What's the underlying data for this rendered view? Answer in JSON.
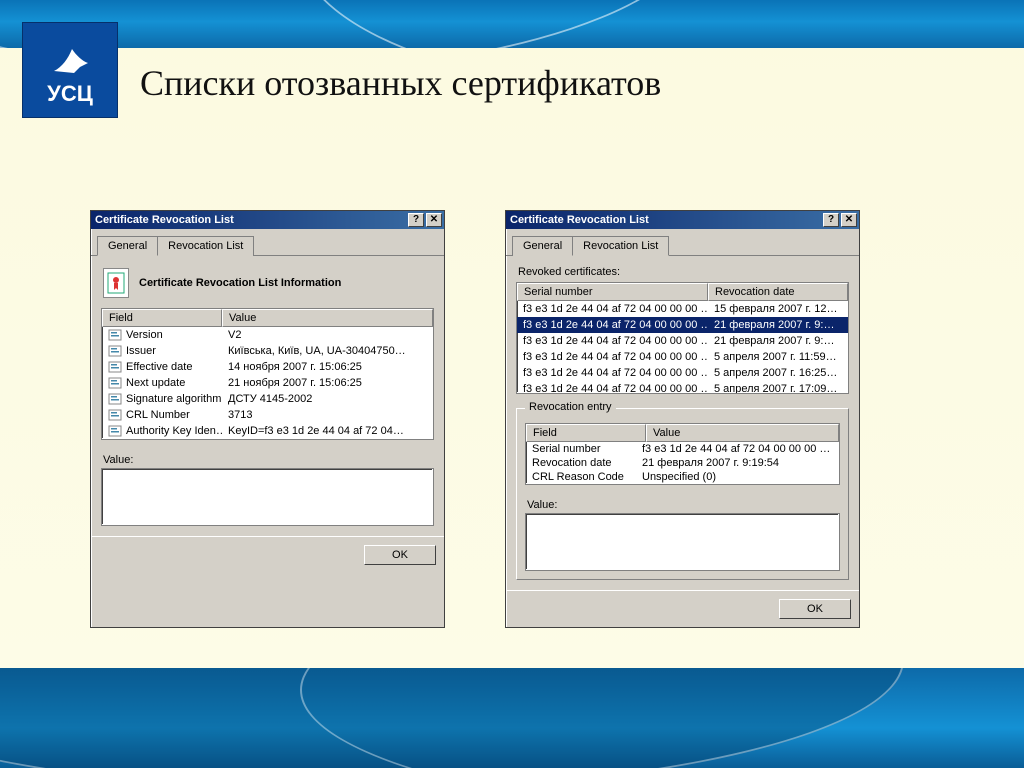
{
  "slide": {
    "title": "Списки отозванных сертификатов"
  },
  "logo": {
    "text": "УСЦ"
  },
  "dialog_general": {
    "title": "Certificate Revocation List",
    "tabs": {
      "general": "General",
      "revlist": "Revocation List"
    },
    "heading": "Certificate Revocation List Information",
    "columns": {
      "field": "Field",
      "value": "Value"
    },
    "rows": [
      {
        "field": "Version",
        "value": "V2"
      },
      {
        "field": "Issuer",
        "value": "Київська, Київ, UA, UA-30404750…"
      },
      {
        "field": "Effective date",
        "value": "14 ноября 2007 г. 15:06:25"
      },
      {
        "field": "Next update",
        "value": "21 ноября 2007 г. 15:06:25"
      },
      {
        "field": "Signature algorithm",
        "value": "ДСТУ 4145-2002"
      },
      {
        "field": "CRL Number",
        "value": "3713"
      },
      {
        "field": "Authority Key Iden…",
        "value": "KeyID=f3 e3 1d 2e 44 04 af 72 04…"
      }
    ],
    "value_label": "Value:",
    "ok": "OK"
  },
  "dialog_revlist": {
    "title": "Certificate Revocation List",
    "tabs": {
      "general": "General",
      "revlist": "Revocation List"
    },
    "list_label": "Revoked certificates:",
    "columns": {
      "serial": "Serial number",
      "revdate": "Revocation date"
    },
    "rows": [
      {
        "serial": "f3 e3 1d 2e 44 04 af 72 04 00 00 00 …",
        "date": "15 февраля 2007 г. 12…",
        "selected": false
      },
      {
        "serial": "f3 e3 1d 2e 44 04 af 72 04 00 00 00 …",
        "date": "21 февраля 2007 г. 9:…",
        "selected": true
      },
      {
        "serial": "f3 e3 1d 2e 44 04 af 72 04 00 00 00 …",
        "date": "21 февраля 2007 г. 9:…",
        "selected": false
      },
      {
        "serial": "f3 e3 1d 2e 44 04 af 72 04 00 00 00 …",
        "date": "5 апреля 2007 г. 11:59…",
        "selected": false
      },
      {
        "serial": "f3 e3 1d 2e 44 04 af 72 04 00 00 00 …",
        "date": "5 апреля 2007 г. 16:25…",
        "selected": false
      },
      {
        "serial": "f3 e3 1d 2e 44 04 af 72 04 00 00 00 …",
        "date": "5 апреля 2007 г. 17:09…",
        "selected": false
      }
    ],
    "entry_group": "Revocation entry",
    "entry_columns": {
      "field": "Field",
      "value": "Value"
    },
    "entry_rows": [
      {
        "field": "Serial number",
        "value": "f3 e3 1d 2e 44 04 af 72 04 00 00 00 …"
      },
      {
        "field": "Revocation date",
        "value": "21 февраля 2007 г. 9:19:54"
      },
      {
        "field": "CRL Reason Code",
        "value": "Unspecified (0)"
      }
    ],
    "value_label": "Value:",
    "ok": "OK"
  }
}
